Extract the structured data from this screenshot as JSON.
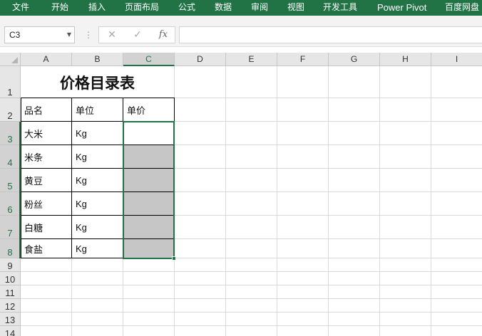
{
  "ribbon": {
    "tabs": [
      "文件",
      "开始",
      "插入",
      "页面布局",
      "公式",
      "数据",
      "审阅",
      "视图",
      "开发工具",
      "Power Pivot",
      "百度网盘"
    ]
  },
  "formula_bar": {
    "name_box": "C3",
    "name_box_arrow": "▼",
    "dots": "⋮",
    "cancel": "✕",
    "enter": "✓",
    "fx": "fx",
    "formula": ""
  },
  "sheet": {
    "columns": [
      "A",
      "B",
      "C",
      "D",
      "E",
      "F",
      "G",
      "H",
      "I"
    ],
    "selected_column": "C",
    "rows": [
      "1",
      "2",
      "3",
      "4",
      "5",
      "6",
      "7",
      "8",
      "9",
      "10",
      "11",
      "12",
      "13",
      "14"
    ],
    "selected_rows": [
      "3",
      "4",
      "5",
      "6",
      "7",
      "8"
    ],
    "title": "价格目录表",
    "headers": [
      "品名",
      "单位",
      "单价"
    ],
    "items": [
      {
        "name": "大米",
        "unit": "Kg",
        "price": ""
      },
      {
        "name": "米条",
        "unit": "Kg",
        "price": ""
      },
      {
        "name": "黄豆",
        "unit": "Kg",
        "price": ""
      },
      {
        "name": "粉丝",
        "unit": "Kg",
        "price": ""
      },
      {
        "name": "白糖",
        "unit": "Kg",
        "price": ""
      },
      {
        "name": "食盐",
        "unit": "Kg",
        "price": ""
      }
    ],
    "shaded_fill_color": "#c6c6c6",
    "selection_color": "#217346"
  },
  "colors": {
    "ribbon_bg": "#217346",
    "header_bg": "#e6e6e6"
  }
}
